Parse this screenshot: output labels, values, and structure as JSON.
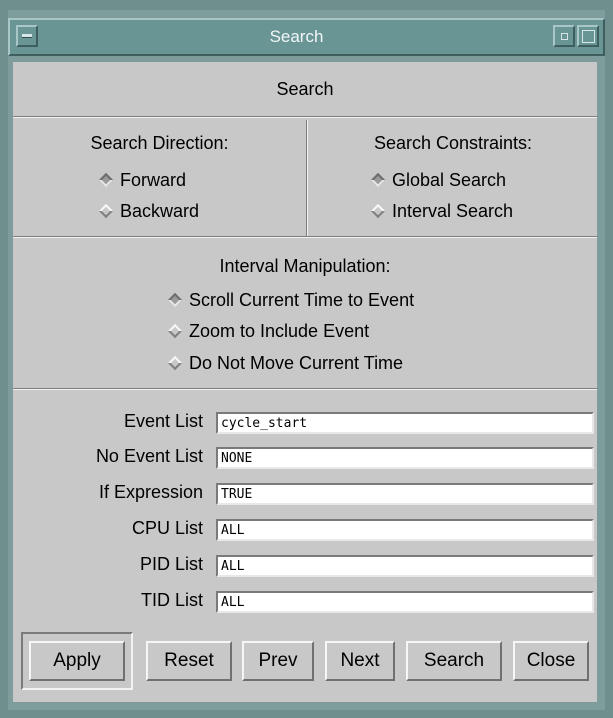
{
  "window": {
    "title": "Search"
  },
  "panel": {
    "heading": "Search"
  },
  "direction": {
    "heading": "Search Direction:",
    "options": [
      {
        "label": "Forward",
        "selected": true
      },
      {
        "label": "Backward",
        "selected": false
      }
    ]
  },
  "constraints": {
    "heading": "Search Constraints:",
    "options": [
      {
        "label": "Global Search",
        "selected": true
      },
      {
        "label": "Interval Search",
        "selected": false
      }
    ]
  },
  "interval": {
    "heading": "Interval Manipulation:",
    "options": [
      {
        "label": "Scroll Current Time to Event",
        "selected": true
      },
      {
        "label": "Zoom to Include Event",
        "selected": false
      },
      {
        "label": "Do Not Move Current Time",
        "selected": false
      }
    ]
  },
  "fields": [
    {
      "label": "Event List",
      "value": "cycle_start"
    },
    {
      "label": "No Event List",
      "value": "NONE"
    },
    {
      "label": "If Expression",
      "value": "TRUE"
    },
    {
      "label": "CPU List",
      "value": "ALL"
    },
    {
      "label": "PID List",
      "value": "ALL"
    },
    {
      "label": "TID List",
      "value": "ALL"
    }
  ],
  "buttons": {
    "apply": "Apply",
    "reset": "Reset",
    "prev": "Prev",
    "next": "Next",
    "search": "Search",
    "close": "Close"
  },
  "colors": {
    "frame": "#6f8e8e",
    "titlebar": "#6a9595",
    "panel": "#c8c8c8",
    "radio_selected": "#9a9a9a"
  }
}
